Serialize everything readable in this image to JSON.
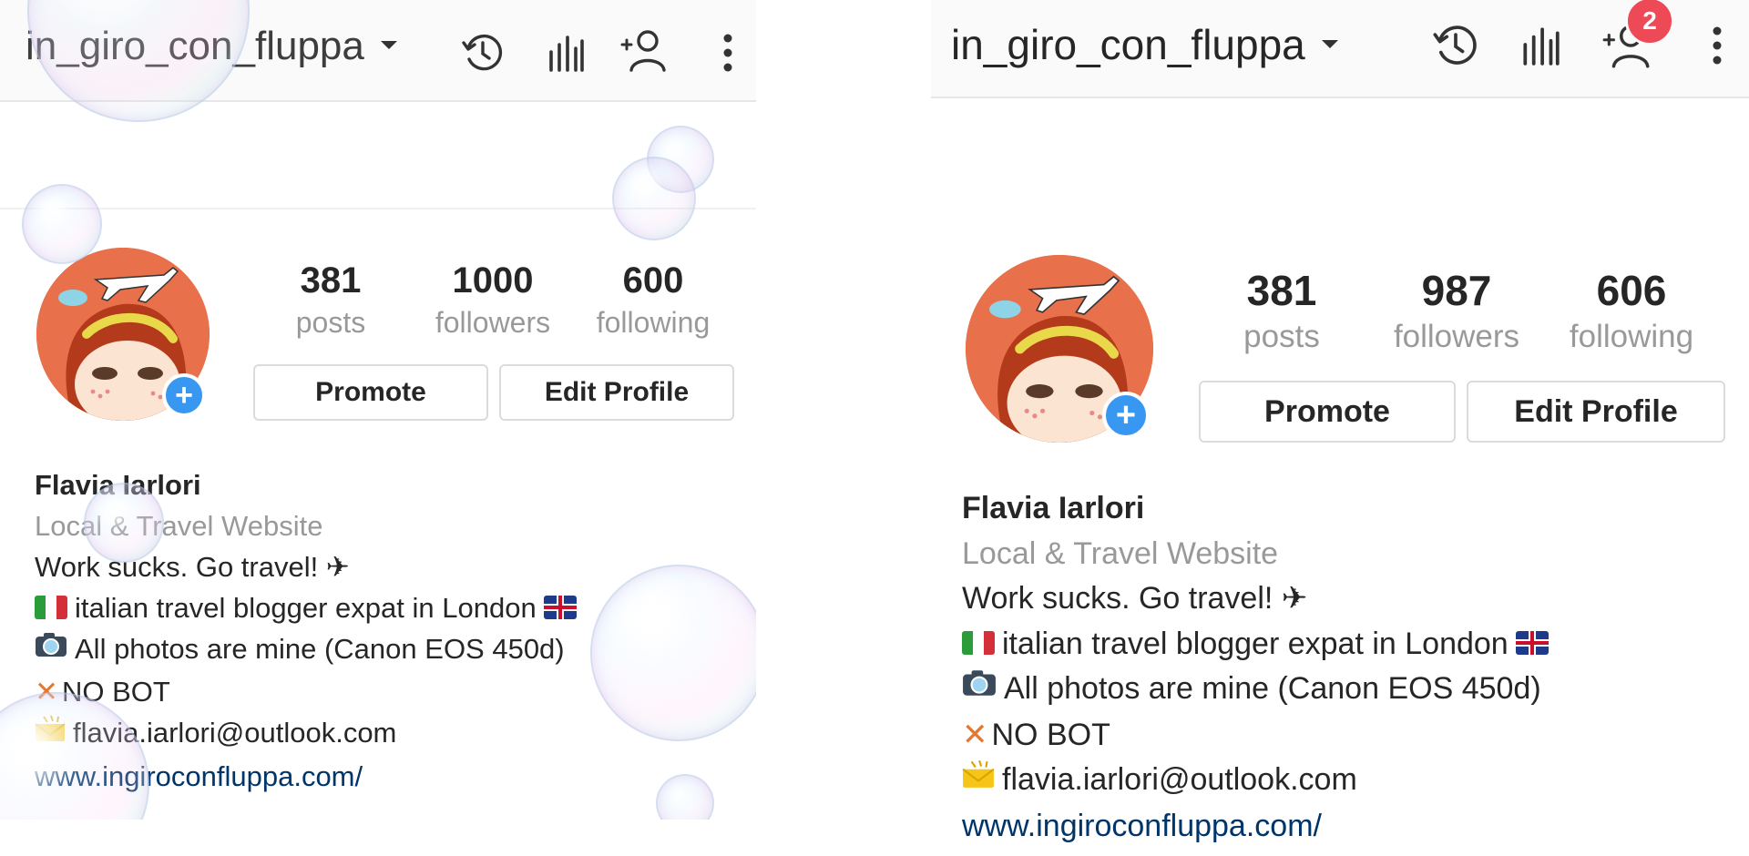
{
  "left": {
    "header": {
      "username": "in_giro_con_fluppa"
    },
    "stats": [
      {
        "value": "381",
        "label": "posts"
      },
      {
        "value": "1000",
        "label": "followers"
      },
      {
        "value": "600",
        "label": "following"
      }
    ],
    "buttons": {
      "promote": "Promote",
      "edit_profile": "Edit Profile"
    },
    "bio": {
      "name": "Flavia Iarlori",
      "category": "Local & Travel Website",
      "line1": "Work sucks. Go travel! ✈",
      "line2": "italian travel blogger expat in London",
      "line3": "All photos are mine (Canon EOS 450d)",
      "line4": "NO BOT",
      "line5": "flavia.iarlori@outlook.com",
      "link": "www.ingiroconfluppa.com/"
    }
  },
  "right": {
    "header": {
      "username": "in_giro_con_fluppa",
      "notification_count": "2"
    },
    "stats": [
      {
        "value": "381",
        "label": "posts"
      },
      {
        "value": "987",
        "label": "followers"
      },
      {
        "value": "606",
        "label": "following"
      }
    ],
    "buttons": {
      "promote": "Promote",
      "edit_profile": "Edit Profile"
    },
    "bio": {
      "name": "Flavia Iarlori",
      "category": "Local & Travel Website",
      "line1": "Work sucks. Go travel! ✈",
      "line2": "italian travel blogger expat in London",
      "line3": "All photos are mine (Canon EOS 450d)",
      "line4": "NO BOT",
      "line5": "flavia.iarlori@outlook.com",
      "link": "www.ingiroconfluppa.com/"
    }
  },
  "icons": [
    "history-icon",
    "insights-icon",
    "add-person-icon",
    "more-options-icon",
    "add-story-plus-icon",
    "airplane-icon",
    "italy-flag-icon",
    "uk-flag-icon",
    "camera-icon",
    "cross-mark-icon",
    "envelope-icon"
  ],
  "colors": {
    "accent_blue": "#3897f0",
    "badge_red": "#ed4956",
    "link_navy": "#003569",
    "muted_gray": "#999999",
    "avatar_orange": "#e8704a"
  }
}
